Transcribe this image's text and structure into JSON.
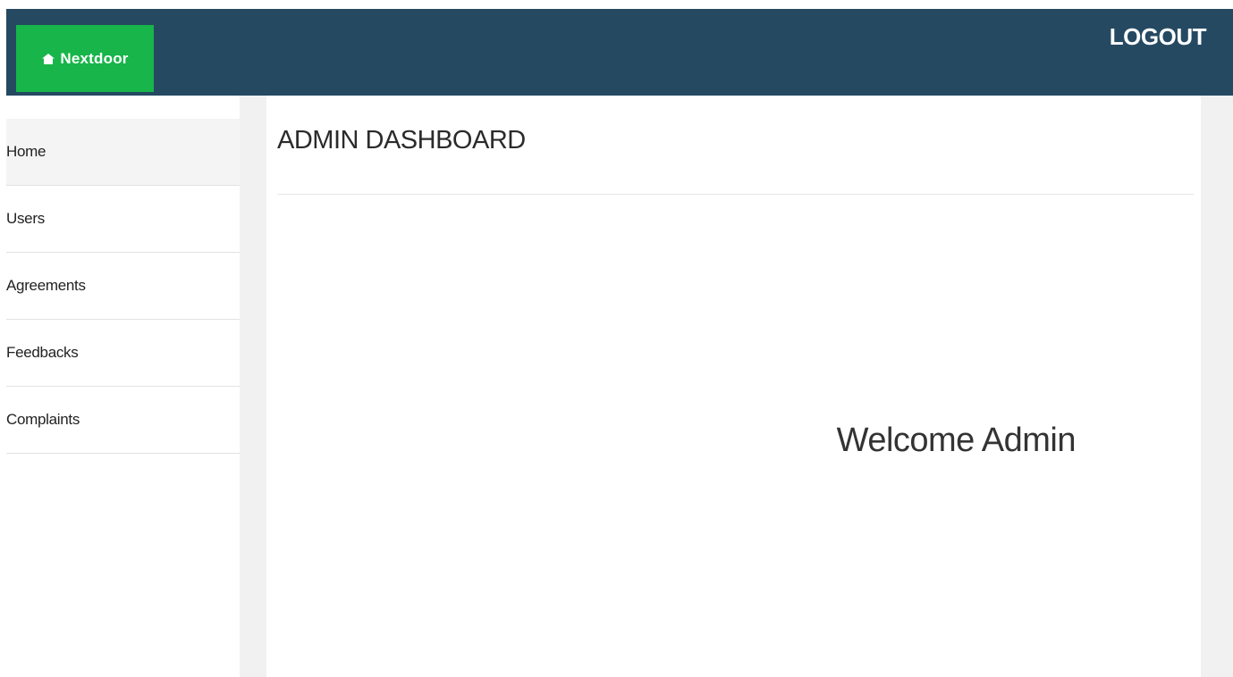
{
  "header": {
    "brand": "Nextdoor",
    "brand_icon": "house-icon",
    "logout_label": "LOGOUT",
    "colors": {
      "bar": "#254961",
      "brand_bg": "#18b54a"
    }
  },
  "sidebar": {
    "items": [
      {
        "label": "Home",
        "active": true
      },
      {
        "label": "Users",
        "active": false
      },
      {
        "label": "Agreements",
        "active": false
      },
      {
        "label": "Feedbacks",
        "active": false
      },
      {
        "label": "Complaints",
        "active": false
      }
    ]
  },
  "main": {
    "title": "ADMIN DASHBOARD",
    "welcome": "Welcome Admin"
  }
}
